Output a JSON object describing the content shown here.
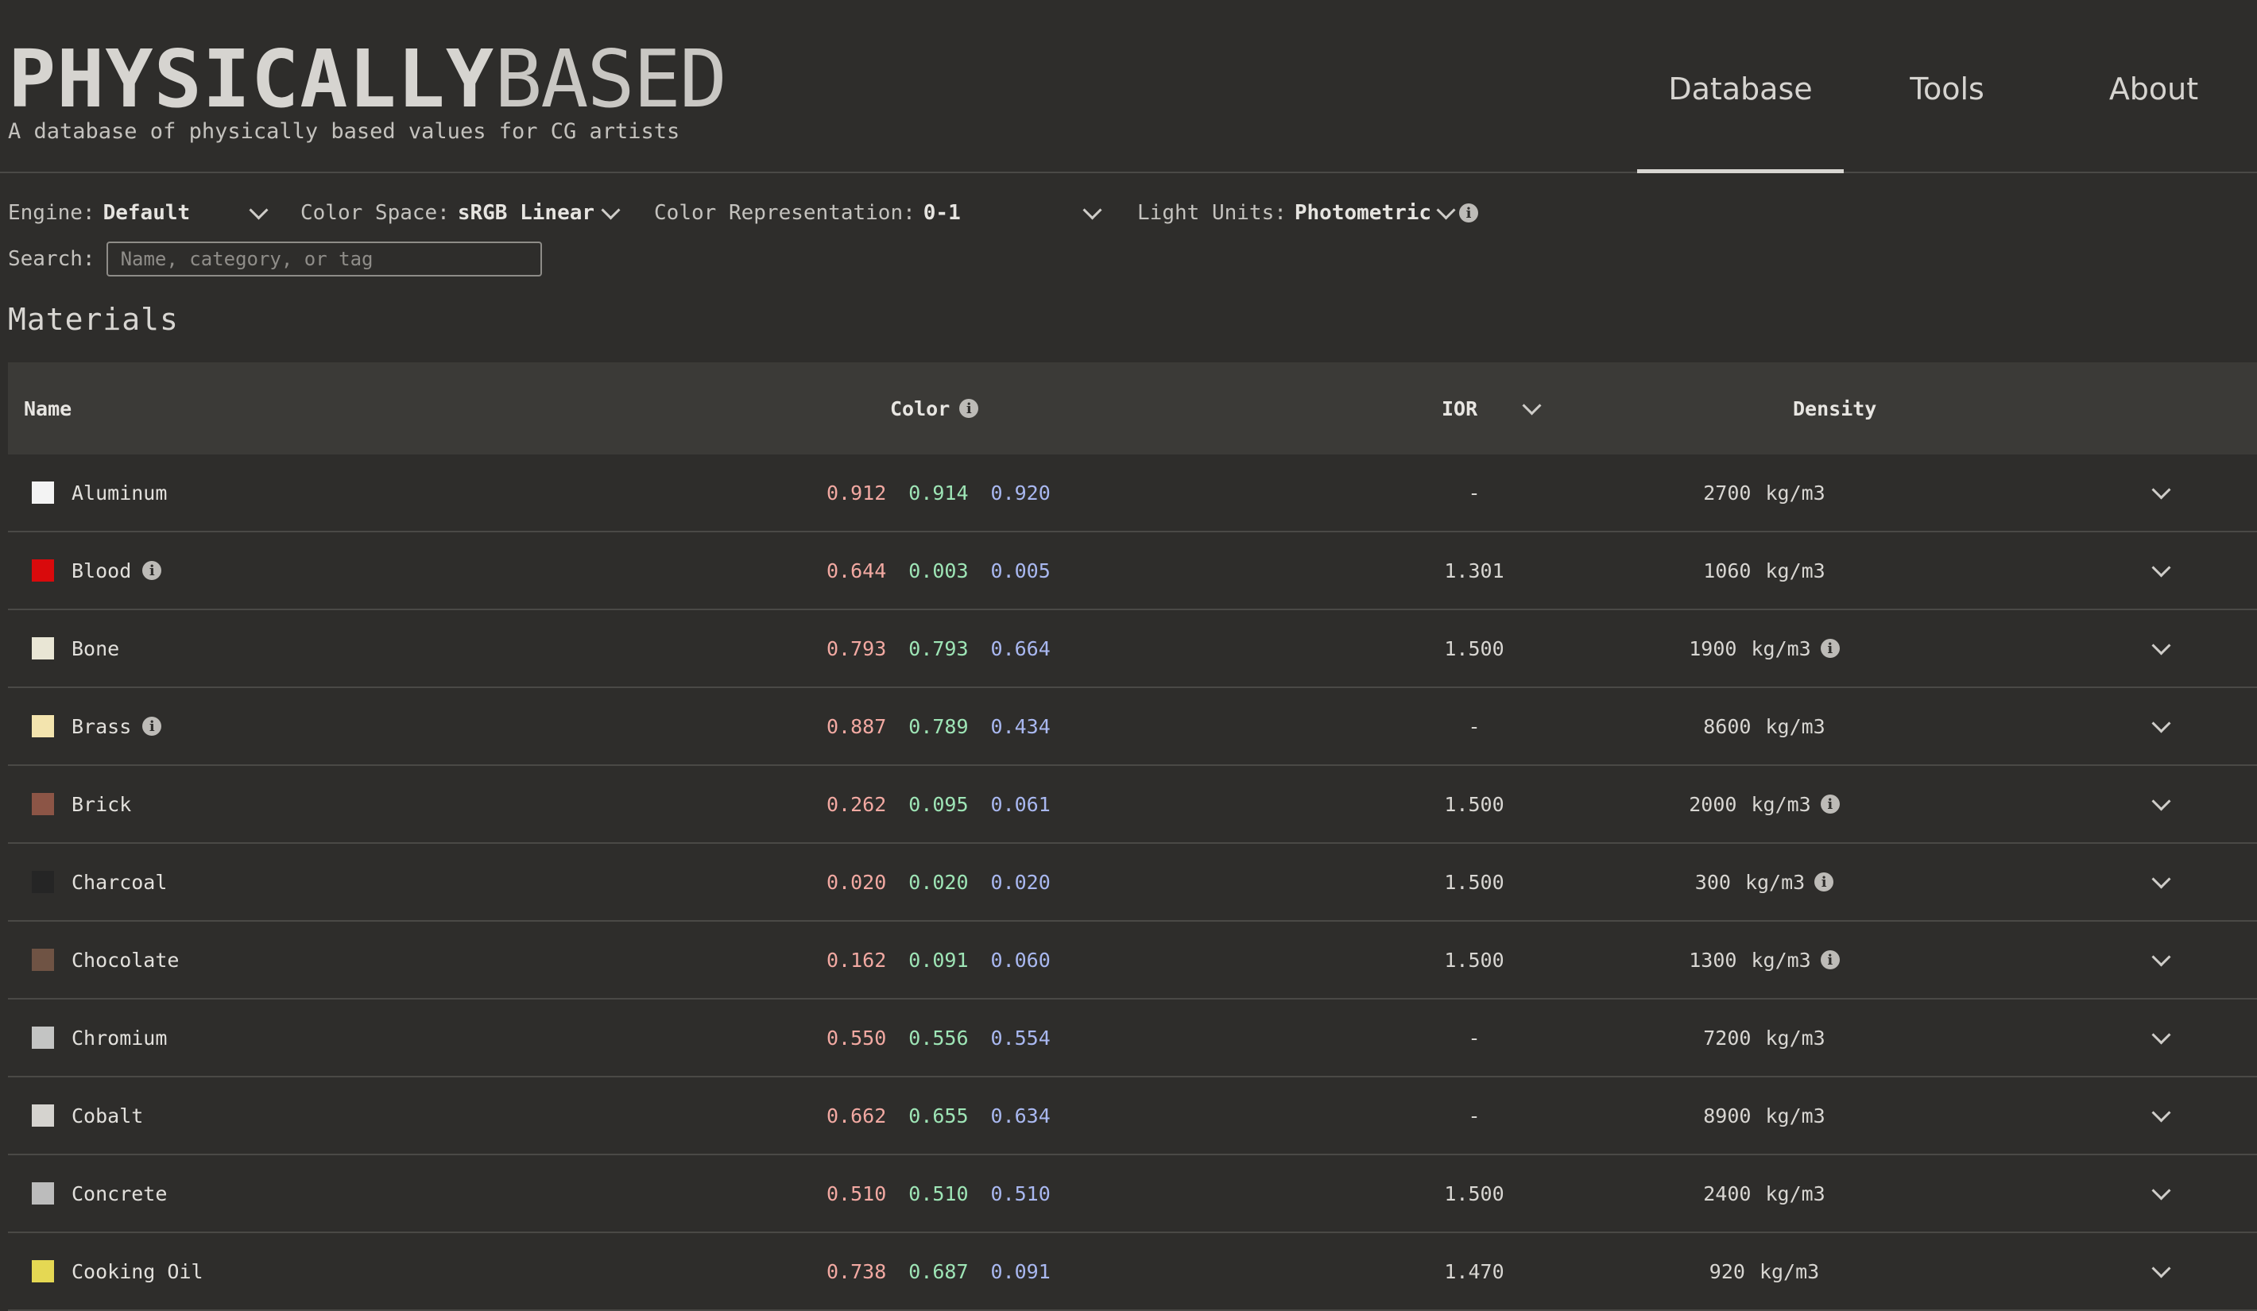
{
  "site": {
    "logo_strong": "PHYSICALLY",
    "logo_light": "BASED",
    "tagline": "A database of physically based values for CG artists"
  },
  "nav": [
    {
      "label": "Database",
      "active": true
    },
    {
      "label": "Tools",
      "active": false
    },
    {
      "label": "About",
      "active": false
    }
  ],
  "filters": {
    "engine": {
      "label": "Engine:",
      "value": "Default"
    },
    "color_space": {
      "label": "Color Space:",
      "value": "sRGB Linear"
    },
    "color_rep": {
      "label": "Color Representation:",
      "value": "0-1"
    },
    "light_units": {
      "label": "Light Units:",
      "value": "Photometric"
    }
  },
  "search": {
    "label": "Search:",
    "placeholder": "Name, category, or tag",
    "value": ""
  },
  "section_title": "Materials",
  "table": {
    "headers": {
      "name": "Name",
      "color": "Color",
      "ior": "IOR",
      "density": "Density"
    },
    "rows": [
      {
        "name": "Aluminum",
        "swatch": "#f3f3f3",
        "info": false,
        "r": "0.912",
        "g": "0.914",
        "b": "0.920",
        "ior": "-",
        "density": "2700",
        "unit": "kg/m3",
        "density_info": false
      },
      {
        "name": "Blood",
        "swatch": "#d90a0c",
        "info": true,
        "r": "0.644",
        "g": "0.003",
        "b": "0.005",
        "ior": "1.301",
        "density": "1060",
        "unit": "kg/m3",
        "density_info": false
      },
      {
        "name": "Bone",
        "swatch": "#e9e6d5",
        "info": false,
        "r": "0.793",
        "g": "0.793",
        "b": "0.664",
        "ior": "1.500",
        "density": "1900",
        "unit": "kg/m3",
        "density_info": true
      },
      {
        "name": "Brass",
        "swatch": "#f3e4ae",
        "info": true,
        "r": "0.887",
        "g": "0.789",
        "b": "0.434",
        "ior": "-",
        "density": "8600",
        "unit": "kg/m3",
        "density_info": false
      },
      {
        "name": "Brick",
        "swatch": "#8c5546",
        "info": false,
        "r": "0.262",
        "g": "0.095",
        "b": "0.061",
        "ior": "1.500",
        "density": "2000",
        "unit": "kg/m3",
        "density_info": true
      },
      {
        "name": "Charcoal",
        "swatch": "#252525",
        "info": false,
        "r": "0.020",
        "g": "0.020",
        "b": "0.020",
        "ior": "1.500",
        "density": "300",
        "unit": "kg/m3",
        "density_info": true
      },
      {
        "name": "Chocolate",
        "swatch": "#6f5344",
        "info": false,
        "r": "0.162",
        "g": "0.091",
        "b": "0.060",
        "ior": "1.500",
        "density": "1300",
        "unit": "kg/m3",
        "density_info": true
      },
      {
        "name": "Chromium",
        "swatch": "#c3c4c3",
        "info": false,
        "r": "0.550",
        "g": "0.556",
        "b": "0.554",
        "ior": "-",
        "density": "7200",
        "unit": "kg/m3",
        "density_info": false
      },
      {
        "name": "Cobalt",
        "swatch": "#d5d3cf",
        "info": false,
        "r": "0.662",
        "g": "0.655",
        "b": "0.634",
        "ior": "-",
        "density": "8900",
        "unit": "kg/m3",
        "density_info": false
      },
      {
        "name": "Concrete",
        "swatch": "#bcbcbc",
        "info": false,
        "r": "0.510",
        "g": "0.510",
        "b": "0.510",
        "ior": "1.500",
        "density": "2400",
        "unit": "kg/m3",
        "density_info": false
      },
      {
        "name": "Cooking Oil",
        "swatch": "#e5d853",
        "info": false,
        "r": "0.738",
        "g": "0.687",
        "b": "0.091",
        "ior": "1.470",
        "density": "920",
        "unit": "kg/m3",
        "density_info": false
      }
    ]
  }
}
